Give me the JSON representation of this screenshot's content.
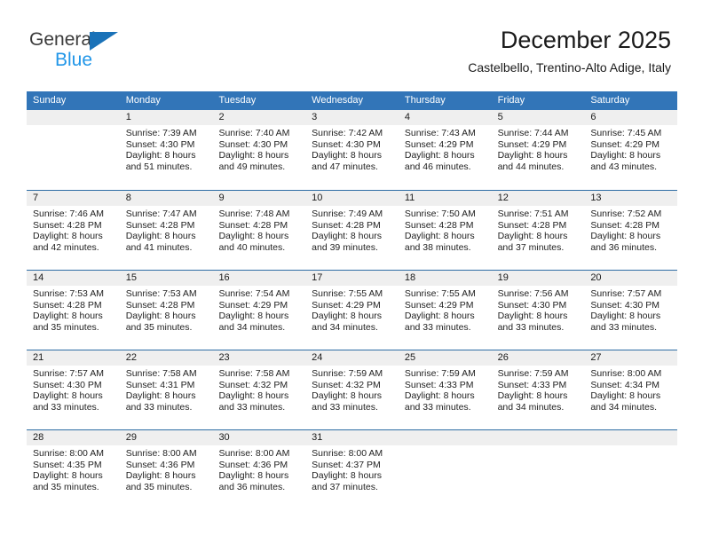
{
  "brand": {
    "name_part1": "General",
    "name_part2": "Blue",
    "triangle_icon": "brand-triangle-icon"
  },
  "header": {
    "title": "December 2025",
    "subtitle": "Castelbello, Trentino-Alto Adige, Italy"
  },
  "colors": {
    "header_blue": "#3275b8",
    "separator_blue": "#2e6da4",
    "daynum_band": "#efefef",
    "brand_dark": "#3b3b3b",
    "brand_blue": "#2196e8",
    "triangle_blue": "#1a72b8"
  },
  "weekdays": [
    "Sunday",
    "Monday",
    "Tuesday",
    "Wednesday",
    "Thursday",
    "Friday",
    "Saturday"
  ],
  "weeks": [
    [
      {
        "day": "",
        "lines": []
      },
      {
        "day": "1",
        "lines": [
          "Sunrise: 7:39 AM",
          "Sunset: 4:30 PM",
          "Daylight: 8 hours",
          "and 51 minutes."
        ]
      },
      {
        "day": "2",
        "lines": [
          "Sunrise: 7:40 AM",
          "Sunset: 4:30 PM",
          "Daylight: 8 hours",
          "and 49 minutes."
        ]
      },
      {
        "day": "3",
        "lines": [
          "Sunrise: 7:42 AM",
          "Sunset: 4:30 PM",
          "Daylight: 8 hours",
          "and 47 minutes."
        ]
      },
      {
        "day": "4",
        "lines": [
          "Sunrise: 7:43 AM",
          "Sunset: 4:29 PM",
          "Daylight: 8 hours",
          "and 46 minutes."
        ]
      },
      {
        "day": "5",
        "lines": [
          "Sunrise: 7:44 AM",
          "Sunset: 4:29 PM",
          "Daylight: 8 hours",
          "and 44 minutes."
        ]
      },
      {
        "day": "6",
        "lines": [
          "Sunrise: 7:45 AM",
          "Sunset: 4:29 PM",
          "Daylight: 8 hours",
          "and 43 minutes."
        ]
      }
    ],
    [
      {
        "day": "7",
        "lines": [
          "Sunrise: 7:46 AM",
          "Sunset: 4:28 PM",
          "Daylight: 8 hours",
          "and 42 minutes."
        ]
      },
      {
        "day": "8",
        "lines": [
          "Sunrise: 7:47 AM",
          "Sunset: 4:28 PM",
          "Daylight: 8 hours",
          "and 41 minutes."
        ]
      },
      {
        "day": "9",
        "lines": [
          "Sunrise: 7:48 AM",
          "Sunset: 4:28 PM",
          "Daylight: 8 hours",
          "and 40 minutes."
        ]
      },
      {
        "day": "10",
        "lines": [
          "Sunrise: 7:49 AM",
          "Sunset: 4:28 PM",
          "Daylight: 8 hours",
          "and 39 minutes."
        ]
      },
      {
        "day": "11",
        "lines": [
          "Sunrise: 7:50 AM",
          "Sunset: 4:28 PM",
          "Daylight: 8 hours",
          "and 38 minutes."
        ]
      },
      {
        "day": "12",
        "lines": [
          "Sunrise: 7:51 AM",
          "Sunset: 4:28 PM",
          "Daylight: 8 hours",
          "and 37 minutes."
        ]
      },
      {
        "day": "13",
        "lines": [
          "Sunrise: 7:52 AM",
          "Sunset: 4:28 PM",
          "Daylight: 8 hours",
          "and 36 minutes."
        ]
      }
    ],
    [
      {
        "day": "14",
        "lines": [
          "Sunrise: 7:53 AM",
          "Sunset: 4:28 PM",
          "Daylight: 8 hours",
          "and 35 minutes."
        ]
      },
      {
        "day": "15",
        "lines": [
          "Sunrise: 7:53 AM",
          "Sunset: 4:28 PM",
          "Daylight: 8 hours",
          "and 35 minutes."
        ]
      },
      {
        "day": "16",
        "lines": [
          "Sunrise: 7:54 AM",
          "Sunset: 4:29 PM",
          "Daylight: 8 hours",
          "and 34 minutes."
        ]
      },
      {
        "day": "17",
        "lines": [
          "Sunrise: 7:55 AM",
          "Sunset: 4:29 PM",
          "Daylight: 8 hours",
          "and 34 minutes."
        ]
      },
      {
        "day": "18",
        "lines": [
          "Sunrise: 7:55 AM",
          "Sunset: 4:29 PM",
          "Daylight: 8 hours",
          "and 33 minutes."
        ]
      },
      {
        "day": "19",
        "lines": [
          "Sunrise: 7:56 AM",
          "Sunset: 4:30 PM",
          "Daylight: 8 hours",
          "and 33 minutes."
        ]
      },
      {
        "day": "20",
        "lines": [
          "Sunrise: 7:57 AM",
          "Sunset: 4:30 PM",
          "Daylight: 8 hours",
          "and 33 minutes."
        ]
      }
    ],
    [
      {
        "day": "21",
        "lines": [
          "Sunrise: 7:57 AM",
          "Sunset: 4:30 PM",
          "Daylight: 8 hours",
          "and 33 minutes."
        ]
      },
      {
        "day": "22",
        "lines": [
          "Sunrise: 7:58 AM",
          "Sunset: 4:31 PM",
          "Daylight: 8 hours",
          "and 33 minutes."
        ]
      },
      {
        "day": "23",
        "lines": [
          "Sunrise: 7:58 AM",
          "Sunset: 4:32 PM",
          "Daylight: 8 hours",
          "and 33 minutes."
        ]
      },
      {
        "day": "24",
        "lines": [
          "Sunrise: 7:59 AM",
          "Sunset: 4:32 PM",
          "Daylight: 8 hours",
          "and 33 minutes."
        ]
      },
      {
        "day": "25",
        "lines": [
          "Sunrise: 7:59 AM",
          "Sunset: 4:33 PM",
          "Daylight: 8 hours",
          "and 33 minutes."
        ]
      },
      {
        "day": "26",
        "lines": [
          "Sunrise: 7:59 AM",
          "Sunset: 4:33 PM",
          "Daylight: 8 hours",
          "and 34 minutes."
        ]
      },
      {
        "day": "27",
        "lines": [
          "Sunrise: 8:00 AM",
          "Sunset: 4:34 PM",
          "Daylight: 8 hours",
          "and 34 minutes."
        ]
      }
    ],
    [
      {
        "day": "28",
        "lines": [
          "Sunrise: 8:00 AM",
          "Sunset: 4:35 PM",
          "Daylight: 8 hours",
          "and 35 minutes."
        ]
      },
      {
        "day": "29",
        "lines": [
          "Sunrise: 8:00 AM",
          "Sunset: 4:36 PM",
          "Daylight: 8 hours",
          "and 35 minutes."
        ]
      },
      {
        "day": "30",
        "lines": [
          "Sunrise: 8:00 AM",
          "Sunset: 4:36 PM",
          "Daylight: 8 hours",
          "and 36 minutes."
        ]
      },
      {
        "day": "31",
        "lines": [
          "Sunrise: 8:00 AM",
          "Sunset: 4:37 PM",
          "Daylight: 8 hours",
          "and 37 minutes."
        ]
      },
      {
        "day": "",
        "lines": []
      },
      {
        "day": "",
        "lines": []
      },
      {
        "day": "",
        "lines": []
      }
    ]
  ]
}
